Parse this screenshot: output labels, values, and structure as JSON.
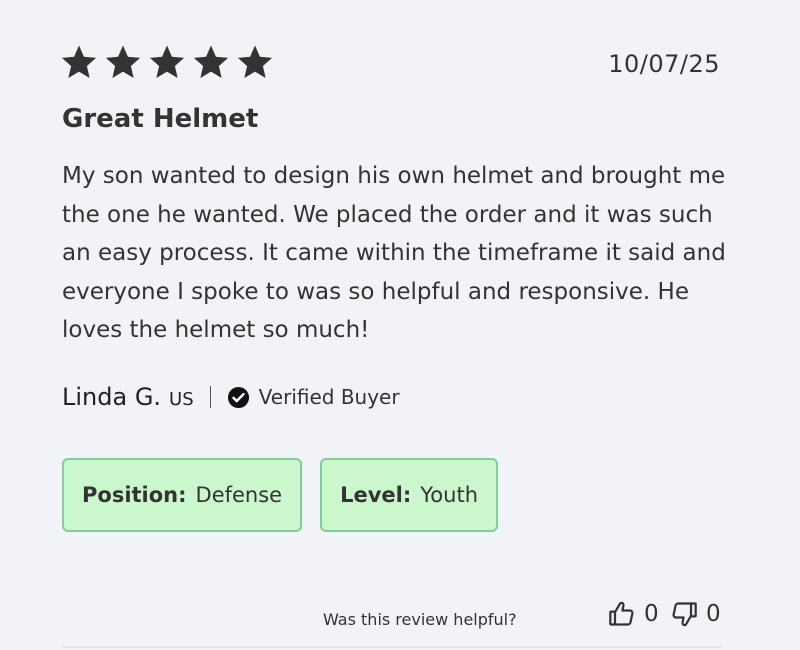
{
  "review": {
    "rating": 5,
    "max_rating": 5,
    "date": "10/07/25",
    "title": "Great Helmet",
    "body": "My son wanted to design his own helmet and brought me the one he wanted. We placed the order and it was such an easy process. It came within the timeframe it said and everyone I spoke to was so helpful and responsive. He loves the helmet so much!",
    "reviewer": {
      "name": "Linda G.",
      "country": "US",
      "verified_label": "Verified Buyer"
    },
    "tags": [
      {
        "key": "Position:",
        "value": "Defense"
      },
      {
        "key": "Level:",
        "value": "Youth"
      }
    ],
    "helpful": {
      "question": "Was this review helpful?",
      "up_count": "0",
      "down_count": "0"
    }
  },
  "icons": {
    "star": "star-icon",
    "verified": "verified-check-icon",
    "thumbs_up": "thumbs-up-icon",
    "thumbs_down": "thumbs-down-icon"
  },
  "colors": {
    "background": "#f2f3f6",
    "star": "#333333",
    "tag_background": "#caf8cc",
    "tag_border": "#7fcf9a"
  }
}
